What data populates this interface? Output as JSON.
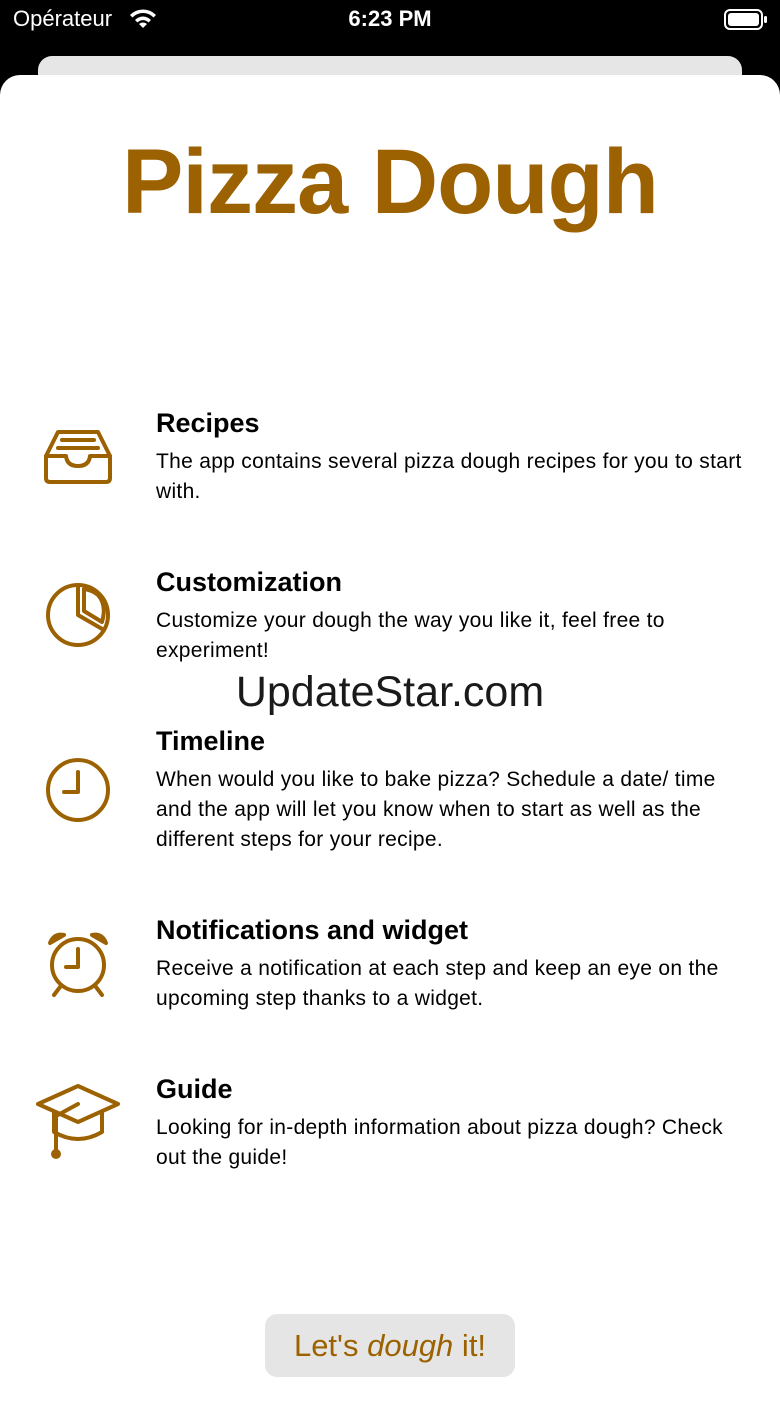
{
  "status_bar": {
    "carrier": "Opérateur",
    "time": "6:23 PM"
  },
  "app": {
    "title": "Pizza Dough",
    "accent_color": "#9c6100"
  },
  "features": [
    {
      "icon": "tray-icon",
      "title": "Recipes",
      "description": "The app contains several pizza dough recipes for you to start with."
    },
    {
      "icon": "pie-chart-icon",
      "title": "Customization",
      "description": "Customize your dough the way you like it, feel free to experiment!"
    },
    {
      "icon": "clock-icon",
      "title": "Timeline",
      "description": "When would you like to bake pizza? Schedule a date/ time and the app will let you know when to start as well as the different steps for your recipe."
    },
    {
      "icon": "alarm-clock-icon",
      "title": "Notifications and widget",
      "description": "Receive a notification at each step and keep an eye on the upcoming step thanks to a widget."
    },
    {
      "icon": "graduation-cap-icon",
      "title": "Guide",
      "description": "Looking for in-depth information about pizza dough? Check out the guide!"
    }
  ],
  "watermark": "UpdateStar.com",
  "cta": {
    "prefix": "Let's ",
    "emphasis": "dough",
    "suffix": " it!"
  }
}
